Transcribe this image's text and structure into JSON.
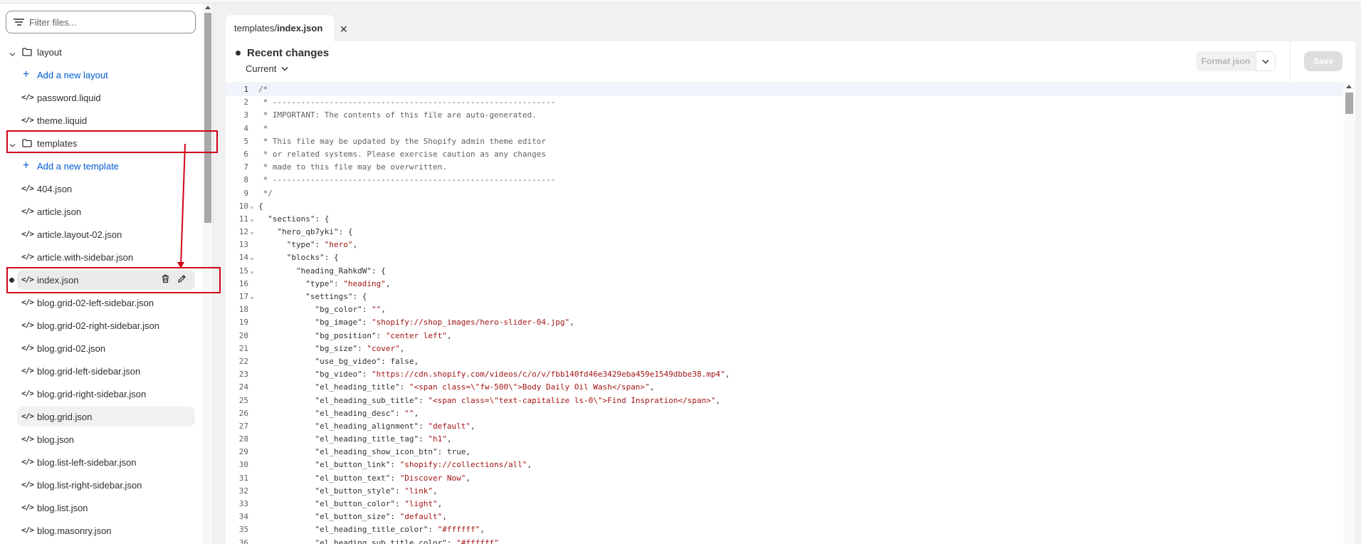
{
  "sidebar": {
    "filter_placeholder": "Filter files...",
    "tree": [
      {
        "kind": "folder",
        "label": "layout"
      },
      {
        "kind": "add",
        "label": "Add a new layout"
      },
      {
        "kind": "file",
        "label": "password.liquid"
      },
      {
        "kind": "file",
        "label": "theme.liquid"
      },
      {
        "kind": "folder",
        "label": "templates"
      },
      {
        "kind": "add",
        "label": "Add a new template"
      },
      {
        "kind": "file",
        "label": "404.json"
      },
      {
        "kind": "file",
        "label": "article.json"
      },
      {
        "kind": "file",
        "label": "article.layout-02.json"
      },
      {
        "kind": "file",
        "label": "article.with-sidebar.json"
      },
      {
        "kind": "file",
        "label": "index.json",
        "active": true
      },
      {
        "kind": "file",
        "label": "blog.grid-02-left-sidebar.json"
      },
      {
        "kind": "file",
        "label": "blog.grid-02-right-sidebar.json"
      },
      {
        "kind": "file",
        "label": "blog.grid-02.json"
      },
      {
        "kind": "file",
        "label": "blog.grid-left-sidebar.json"
      },
      {
        "kind": "file",
        "label": "blog.grid-right-sidebar.json"
      },
      {
        "kind": "file",
        "label": "blog.grid.json",
        "hover": true
      },
      {
        "kind": "file",
        "label": "blog.json"
      },
      {
        "kind": "file",
        "label": "blog.list-left-sidebar.json"
      },
      {
        "kind": "file",
        "label": "blog.list-right-sidebar.json"
      },
      {
        "kind": "file",
        "label": "blog.list.json"
      },
      {
        "kind": "file",
        "label": "blog.masonry.json"
      }
    ],
    "code_glyph": "</>"
  },
  "tab": {
    "path": "templates/",
    "filename": "index.json",
    "close": "✕"
  },
  "toolbar": {
    "recent_changes": "Recent changes",
    "version_select": "Current",
    "format_label": "Format json",
    "save_label": "Save"
  },
  "colors": {
    "accent": "#005bd3",
    "annotation": "#d0021b",
    "string": "#a31515"
  },
  "code": {
    "lines": [
      {
        "n": 1,
        "text": "/*",
        "t": "cm"
      },
      {
        "n": 2,
        "text": " * ------------------------------------------------------------",
        "t": "cm"
      },
      {
        "n": 3,
        "text": " * IMPORTANT: The contents of this file are auto-generated.",
        "t": "cm"
      },
      {
        "n": 4,
        "text": " *",
        "t": "cm"
      },
      {
        "n": 5,
        "text": " * This file may be updated by the Shopify admin theme editor",
        "t": "cm"
      },
      {
        "n": 6,
        "text": " * or related systems. Please exercise caution as any changes",
        "t": "cm"
      },
      {
        "n": 7,
        "text": " * made to this file may be overwritten.",
        "t": "cm"
      },
      {
        "n": 8,
        "text": " * ------------------------------------------------------------",
        "t": "cm"
      },
      {
        "n": 9,
        "text": " */",
        "t": "cm"
      },
      {
        "n": 10,
        "text": "{",
        "fold": true
      },
      {
        "n": 11,
        "text": "  \"sections\": {",
        "fold": true
      },
      {
        "n": 12,
        "text": "    \"hero_qb7yki\": {",
        "fold": true
      },
      {
        "n": 13,
        "key": "      \"type\": ",
        "val": "\"hero\"",
        "tail": ","
      },
      {
        "n": 14,
        "text": "      \"blocks\": {",
        "fold": true
      },
      {
        "n": 15,
        "text": "        \"heading_RahkdW\": {",
        "fold": true
      },
      {
        "n": 16,
        "key": "          \"type\": ",
        "val": "\"heading\"",
        "tail": ","
      },
      {
        "n": 17,
        "text": "          \"settings\": {",
        "fold": true
      },
      {
        "n": 18,
        "key": "            \"bg_color\": ",
        "val": "\"\"",
        "tail": ","
      },
      {
        "n": 19,
        "key": "            \"bg_image\": ",
        "val": "\"shopify://shop_images/hero-slider-04.jpg\"",
        "tail": ","
      },
      {
        "n": 20,
        "key": "            \"bg_position\": ",
        "val": "\"center left\"",
        "tail": ","
      },
      {
        "n": 21,
        "key": "            \"bg_size\": ",
        "val": "\"cover\"",
        "tail": ","
      },
      {
        "n": 22,
        "text": "            \"use_bg_video\": false,"
      },
      {
        "n": 23,
        "key": "            \"bg_video\": ",
        "val": "\"https://cdn.shopify.com/videos/c/o/v/fbb140fd46e3429eba459e1549dbbe38.mp4\"",
        "tail": ","
      },
      {
        "n": 24,
        "key": "            \"el_heading_title\": ",
        "val": "\"<span class=\\\"fw-500\\\">Body Daily Oil Wash</span>\"",
        "tail": ","
      },
      {
        "n": 25,
        "key": "            \"el_heading_sub_title\": ",
        "val": "\"<span class=\\\"text-capitalize ls-0\\\">Find Inspration</span>\"",
        "tail": ","
      },
      {
        "n": 26,
        "key": "            \"el_heading_desc\": ",
        "val": "\"\"",
        "tail": ","
      },
      {
        "n": 27,
        "key": "            \"el_heading_alignment\": ",
        "val": "\"default\"",
        "tail": ","
      },
      {
        "n": 28,
        "key": "            \"el_heading_title_tag\": ",
        "val": "\"h1\"",
        "tail": ","
      },
      {
        "n": 29,
        "text": "            \"el_heading_show_icon_btn\": true,"
      },
      {
        "n": 30,
        "key": "            \"el_button_link\": ",
        "val": "\"shopify://collections/all\"",
        "tail": ","
      },
      {
        "n": 31,
        "key": "            \"el_button_text\": ",
        "val": "\"Discover Now\"",
        "tail": ","
      },
      {
        "n": 32,
        "key": "            \"el_button_style\": ",
        "val": "\"link\"",
        "tail": ","
      },
      {
        "n": 33,
        "key": "            \"el_button_color\": ",
        "val": "\"light\"",
        "tail": ","
      },
      {
        "n": 34,
        "key": "            \"el_button_size\": ",
        "val": "\"default\"",
        "tail": ","
      },
      {
        "n": 35,
        "key": "            \"el_heading_title_color\": ",
        "val": "\"#ffffff\"",
        "tail": ","
      },
      {
        "n": 36,
        "key": "            \"el_heading_sub_title_color\": ",
        "val": "\"#ffffff\"",
        "tail": ","
      }
    ]
  }
}
